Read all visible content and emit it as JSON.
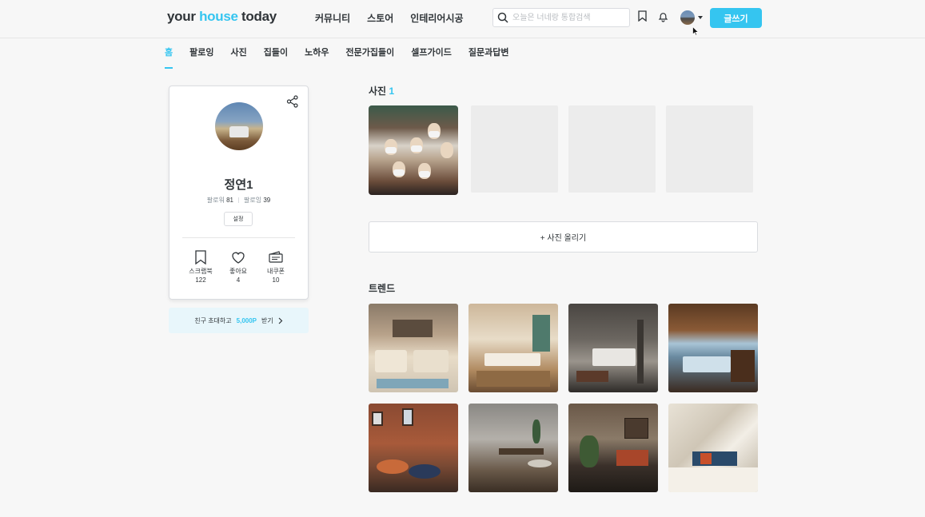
{
  "header": {
    "logo_prefix": "your ",
    "logo_accent": "house",
    "logo_suffix": " today",
    "nav": [
      "커뮤니티",
      "스토어",
      "인테리어시공"
    ],
    "search_placeholder": "오늘은 너네랑 통합검색",
    "write_label": "글쓰기"
  },
  "subnav": {
    "items": [
      "홈",
      "팔로잉",
      "사진",
      "집들이",
      "노하우",
      "전문가집들이",
      "셀프가이드",
      "질문과답변"
    ],
    "active_index": 0
  },
  "profile": {
    "name": "정연1",
    "follower_label": "팔로워",
    "follower_count": "81",
    "following_label": "팔로잉",
    "following_count": "39",
    "settings_label": "설정",
    "stats": [
      {
        "icon": "bookmark-icon",
        "label": "스크랩북",
        "value": "122"
      },
      {
        "icon": "heart-icon",
        "label": "좋아요",
        "value": "4"
      },
      {
        "icon": "coupon-icon",
        "label": "내쿠폰",
        "value": "10"
      }
    ]
  },
  "invite": {
    "text": "친구 초대하고",
    "points": "5,000P",
    "suffix": "받기"
  },
  "photos": {
    "title": "사진",
    "count": "1",
    "upload_label": "+ 사진 올리기"
  },
  "trends": {
    "title": "트렌드"
  },
  "colors": {
    "accent": "#35c5f0",
    "text": "#2f3438",
    "muted": "#828c94"
  }
}
